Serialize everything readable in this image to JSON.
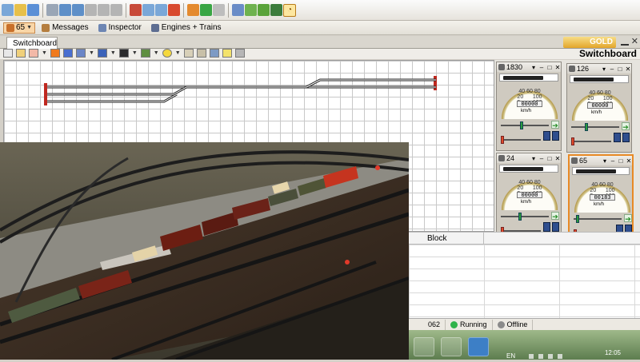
{
  "toolbar": {
    "icons": [
      "new-icon",
      "open-icon",
      "save-icon",
      "print-icon",
      "undo-icon",
      "redo-icon",
      "cut-icon",
      "copy-icon",
      "paste-icon",
      "delete-icon",
      "grid-icon",
      "zoom-icon",
      "stop-icon",
      "power-icon",
      "run-icon",
      "lock-icon",
      "wizard-icon",
      "route-icon",
      "signal-icon",
      "turnout-icon",
      "clock-icon"
    ],
    "icon_colors": [
      "#7aa7d8",
      "#e7c04a",
      "#5b8fd6",
      "#9aa6b6",
      "#5e8fc8",
      "#5e8fc8",
      "#b4b4b4",
      "#b4b4b4",
      "#b4b4b4",
      "#c84a3a",
      "#7aa7d8",
      "#7aa7d8",
      "#d84a2f",
      "#e48a2f",
      "#39a544",
      "#bdbdbd",
      "#6a8cc7",
      "#6fb24f",
      "#5aa33a",
      "#3c7c3c",
      "#9c9c9c",
      "#6d87c9",
      "#c54b49",
      "#b43c3c",
      "#d6a34c",
      "#f6d67a"
    ]
  },
  "views": {
    "loco_id": "65",
    "messages_label": "Messages",
    "inspector_label": "Inspector",
    "engines_label": "Engines + Trains"
  },
  "tab": {
    "label": "Switchboard",
    "logo_text": "GOLD"
  },
  "panel": {
    "title": "Switchboard"
  },
  "throttles": [
    {
      "id": "1830",
      "odometer": "00000",
      "scale": "40 60 80\n20      100\n0        120",
      "unit": "km/h",
      "speed_fraction": 0.42
    },
    {
      "id": "126",
      "odometer": "00000",
      "scale": "40 60 80\n20      100\n0        120",
      "unit": "km/h",
      "speed_fraction": 0.3
    },
    {
      "id": "24",
      "odometer": "00000",
      "scale": "40 60 80\n20      100\n0        120",
      "unit": "km/h",
      "speed_fraction": 0.4
    },
    {
      "id": "65",
      "odometer": "00183",
      "scale": "40 60 80\n20      100\n0        120",
      "unit": "km/h",
      "speed_fraction": 0.05
    }
  ],
  "block_table": {
    "header": "Block"
  },
  "status": {
    "code": "062",
    "running_label": "Running",
    "offline_label": "Offline",
    "running_color": "#2fb34a",
    "offline_color": "#8a8a8a"
  },
  "taskbar": {
    "lang": "EN",
    "time": "12:05"
  }
}
